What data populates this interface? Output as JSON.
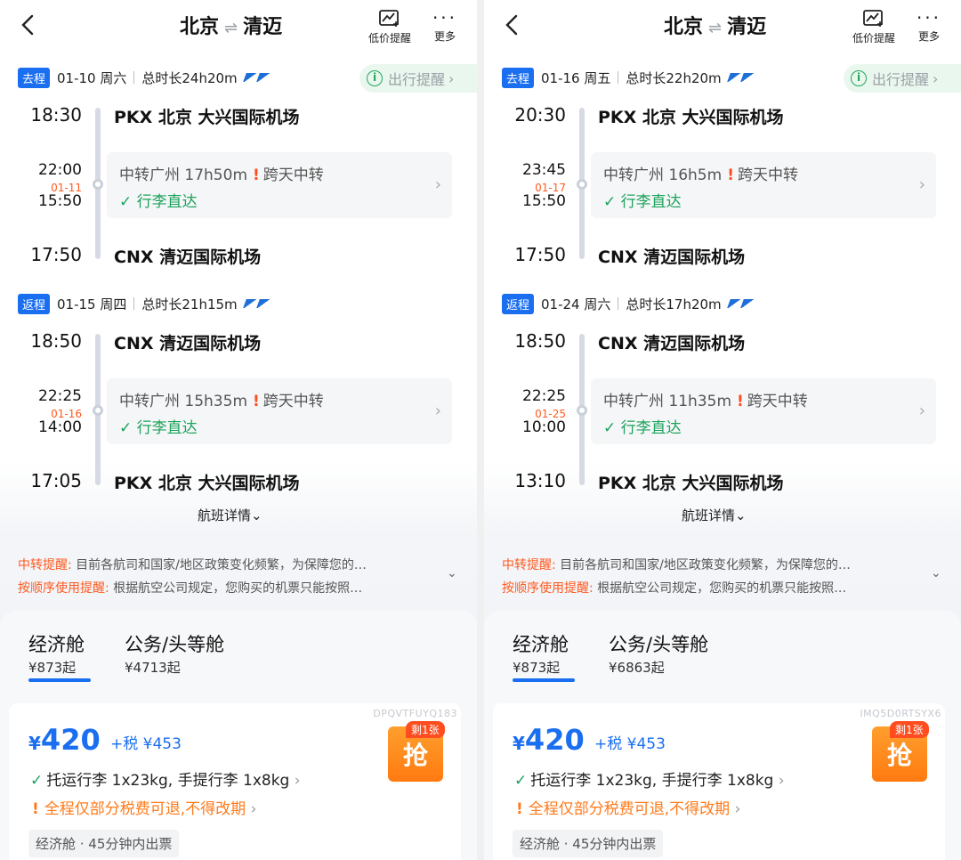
{
  "panels": [
    {
      "title_from": "北京",
      "title_to": "清迈",
      "alert_label": "低价提醒",
      "more_label": "更多",
      "travel_tip": "出行提醒",
      "outbound": {
        "tag": "去程",
        "date": "01-10 周六",
        "duration": "总时长24h20m",
        "dep_time": "18:30",
        "dep_airport": "PKX  北京 大兴国际机场",
        "transfer_arr": "22:00",
        "transfer_nextday": "01-11",
        "transfer_dep": "15:50",
        "transfer_text": "中转广州 17h50m",
        "transfer_warn": "跨天中转",
        "transfer_baggage": "行李直达",
        "arr_time": "17:50",
        "arr_airport": "CNX    清迈国际机场"
      },
      "return": {
        "tag": "返程",
        "date": "01-15 周四",
        "duration": "总时长21h15m",
        "dep_time": "18:50",
        "dep_airport": "CNX    清迈国际机场",
        "transfer_arr": "22:25",
        "transfer_nextday": "01-16",
        "transfer_dep": "14:00",
        "transfer_text": "中转广州 15h35m",
        "transfer_warn": "跨天中转",
        "transfer_baggage": "行李直达",
        "arr_time": "17:05",
        "arr_airport": "PKX  北京 大兴国际机场"
      },
      "flight_details": "航班详情",
      "note1_label": "中转提醒:",
      "note1_text": "目前各航司和国家/地区政策变化频繁，为保障您的…",
      "note2_label": "按顺序使用提醒:",
      "note2_text": "根据航空公司规定，您购买的机票只能按照…",
      "cabin_economy": "经济舱",
      "cabin_economy_price": "¥873起",
      "cabin_business": "公务/头等舱",
      "cabin_business_price": "¥4713起",
      "fare_code": "DPQVTFUYQ183",
      "price_symbol": "¥",
      "price_value": "420",
      "tax": "+税 ¥453",
      "baggage": "托运行李 1x23kg, 手提行李 1x8kg",
      "refund": "全程仅部分税费可退,不得改期",
      "chip": "经济舱 · 45分钟内出票",
      "remain": "剩1张",
      "grab": "抢"
    },
    {
      "title_from": "北京",
      "title_to": "清迈",
      "alert_label": "低价提醒",
      "more_label": "更多",
      "travel_tip": "出行提醒",
      "outbound": {
        "tag": "去程",
        "date": "01-16 周五",
        "duration": "总时长22h20m",
        "dep_time": "20:30",
        "dep_airport": "PKX  北京 大兴国际机场",
        "transfer_arr": "23:45",
        "transfer_nextday": "01-17",
        "transfer_dep": "15:50",
        "transfer_text": "中转广州 16h5m",
        "transfer_warn": "跨天中转",
        "transfer_baggage": "行李直达",
        "arr_time": "17:50",
        "arr_airport": "CNX    清迈国际机场"
      },
      "return": {
        "tag": "返程",
        "date": "01-24 周六",
        "duration": "总时长17h20m",
        "dep_time": "18:50",
        "dep_airport": "CNX    清迈国际机场",
        "transfer_arr": "22:25",
        "transfer_nextday": "01-25",
        "transfer_dep": "10:00",
        "transfer_text": "中转广州 11h35m",
        "transfer_warn": "跨天中转",
        "transfer_baggage": "行李直达",
        "arr_time": "13:10",
        "arr_airport": "PKX  北京 大兴国际机场"
      },
      "flight_details": "航班详情",
      "note1_label": "中转提醒:",
      "note1_text": "目前各航司和国家/地区政策变化频繁，为保障您的…",
      "note2_label": "按顺序使用提醒:",
      "note2_text": "根据航空公司规定，您购买的机票只能按照…",
      "cabin_economy": "经济舱",
      "cabin_economy_price": "¥873起",
      "cabin_business": "公务/头等舱",
      "cabin_business_price": "¥6863起",
      "fare_code": "IMQ5D0RTSYX6",
      "price_symbol": "¥",
      "price_value": "420",
      "tax": "+税 ¥453",
      "baggage": "托运行李 1x23kg, 手提行李 1x8kg",
      "refund": "全程仅部分税费可退,不得改期",
      "chip": "经济舱 · 45分钟内出票",
      "remain": "剩1张",
      "grab": "抢"
    }
  ]
}
